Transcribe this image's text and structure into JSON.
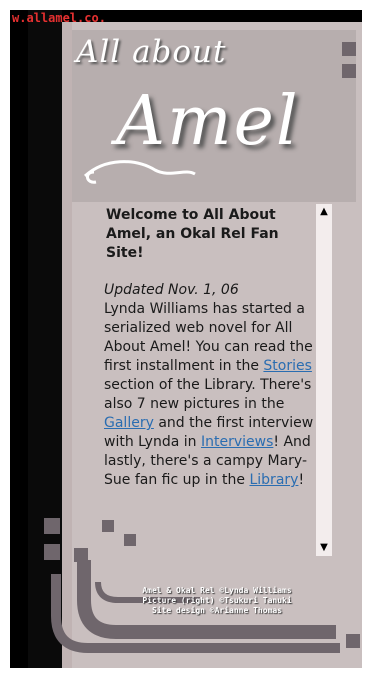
{
  "header": {
    "url": "w.allamel.co.",
    "logo_line1": "All about",
    "logo_line2": "Amel"
  },
  "content": {
    "welcome": "Welcome to All About Amel, an Okal Rel Fan Site!",
    "updated": "Updated Nov. 1, 06",
    "text1": "Lynda Williams has started a serialized web novel for All About Amel! You can read the first installment in the",
    "link_stories": "Stories",
    "text2": "section of the Library. There's also 7 new pictures in the",
    "link_gallery": "Gallery",
    "text3": "and the first interview with Lynda in",
    "link_interviews": "Interviews",
    "text4": "! And lastly, there's a campy Mary-Sue fan fic up in the",
    "link_library": "Library",
    "text5": "!"
  },
  "scrollbar": {
    "up": "▲",
    "down": "▼"
  },
  "footer": {
    "line1": "Amel & Okal Rel ©Lynda Williams",
    "line2": "Picture (right) ©Tsukuri Tanuki",
    "line3": "Site design ©Arianne Thomas"
  },
  "colors": {
    "background": "#c9bfbf",
    "frame": "#000000",
    "accent_squares": "#6f666c",
    "link": "#2a6db1",
    "url_text": "#e53030"
  }
}
